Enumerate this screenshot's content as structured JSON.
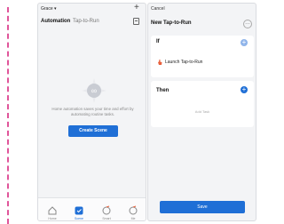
{
  "left_screen": {
    "home_name": "Grace ▾",
    "add_button": "+",
    "tabs": [
      {
        "label": "Automation"
      },
      {
        "label": "Tap-to-Run"
      }
    ],
    "empty_state": {
      "icon_text": "∞",
      "message": "Home automation saves your time and effort by automating routine tasks.",
      "button_label": "Create Scene"
    },
    "bottom_nav": [
      {
        "label": "Home",
        "icon": "home-icon"
      },
      {
        "label": "Scene",
        "icon": "scene-icon"
      },
      {
        "label": "Smart",
        "icon": "smart-icon"
      },
      {
        "label": "Me",
        "icon": "me-icon"
      }
    ]
  },
  "right_screen": {
    "cancel_label": "Cancel",
    "title": "New Tap-to-Run",
    "more_button": "…",
    "if_section": {
      "label": "If",
      "add_button": "+",
      "condition_label": "Launch Tap-to-Run"
    },
    "then_section": {
      "label": "Then",
      "add_button": "+",
      "placeholder": "Add Task"
    },
    "save_label": "Save"
  },
  "colors": {
    "accent": "#1f6fd6",
    "light_accent": "#8fb4ea",
    "marker": "#e0559a",
    "hand": "#e8603c"
  }
}
